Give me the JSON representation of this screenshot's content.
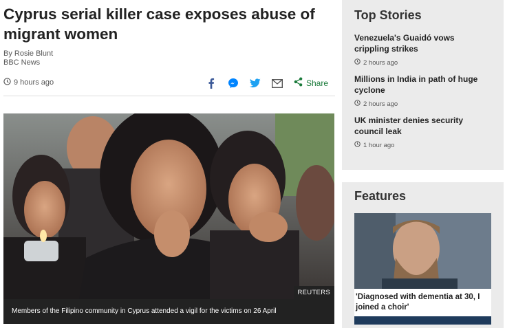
{
  "article": {
    "headline": "Cyprus serial killer case exposes abuse of migrant women",
    "author": "By Rosie Blunt",
    "source": "BBC News",
    "time_ago": "9 hours ago",
    "share_label": "Share",
    "photo_credit": "REUTERS",
    "caption": "Members of the Filipino community in Cyprus attended a vigil for the victims on 26 April"
  },
  "share": {
    "icons": [
      "facebook-icon",
      "messenger-icon",
      "twitter-icon",
      "email-icon",
      "share-icon"
    ]
  },
  "top_stories": {
    "title": "Top Stories",
    "items": [
      {
        "title": "Venezuela's Guaidó vows crippling strikes",
        "time": "2 hours ago"
      },
      {
        "title": "Millions in India in path of huge cyclone",
        "time": "2 hours ago"
      },
      {
        "title": "UK minister denies security council leak",
        "time": "1 hour ago"
      }
    ]
  },
  "features": {
    "title": "Features",
    "items": [
      {
        "title": "'Diagnosed with dementia at 30, I joined a choir'"
      }
    ]
  },
  "colors": {
    "sidebar_bg": "#ebebeb",
    "share_green": "#1a7a3a",
    "facebook": "#3b5998",
    "messenger": "#0084ff",
    "twitter": "#1da1f2"
  }
}
